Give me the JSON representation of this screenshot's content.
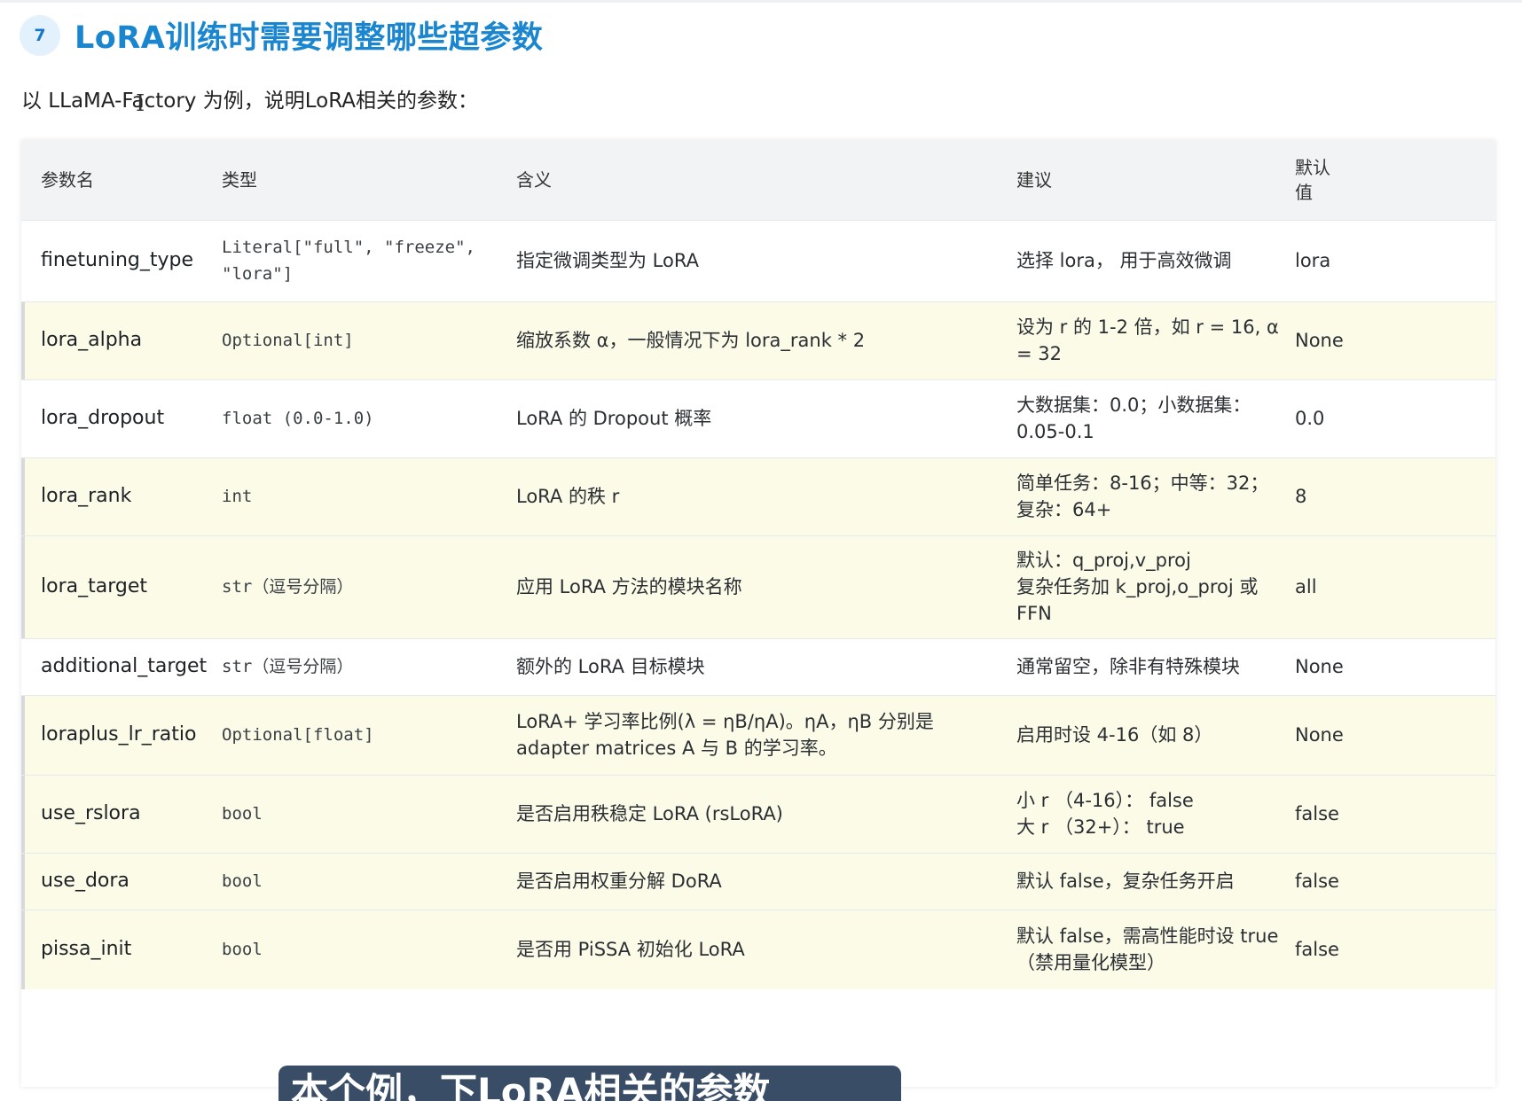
{
  "section": {
    "number": "7",
    "title": "LoRA训练时需要调整哪些超参数"
  },
  "intro": "以 LLaMA-Factory 为例，说明LoRA相关的参数：",
  "cursor": "I",
  "table": {
    "headers": [
      "参数名",
      "类型",
      "含义",
      "建议",
      "默认值"
    ],
    "rows": [
      {
        "name": "finetuning_type",
        "type": "Literal[\"full\", \"freeze\", \"lora\"]",
        "meaning": "指定微调类型为 LoRA",
        "suggestion": "选择 lora， 用于高效微调",
        "default": "lora",
        "alt": false
      },
      {
        "name": "lora_alpha",
        "type": "Optional[int]",
        "meaning": "缩放系数 α，一般情况下为 lora_rank * 2",
        "suggestion": "设为 r 的 1-2 倍，如 r = 16, α = 32",
        "default": "None",
        "alt": true
      },
      {
        "name": "lora_dropout",
        "type": "float (0.0-1.0)",
        "meaning": "LoRA 的 Dropout 概率",
        "suggestion": "大数据集：0.0；小数据集：0.05-0.1",
        "default": "0.0",
        "alt": false
      },
      {
        "name": "lora_rank",
        "type": "int",
        "meaning": "LoRA 的秩 r",
        "suggestion": "简单任务：8-16；中等：32；复杂：64+",
        "default": "8",
        "alt": true
      },
      {
        "name": "lora_target",
        "type": "str（逗号分隔）",
        "meaning": "应用 LoRA 方法的模块名称",
        "suggestion": "默认：q_proj,v_proj\n复杂任务加 k_proj,o_proj 或 FFN",
        "default": "all",
        "alt": true
      },
      {
        "name": "additional_target",
        "type": "str（逗号分隔）",
        "meaning": "额外的 LoRA 目标模块",
        "suggestion": "通常留空，除非有特殊模块",
        "default": "None",
        "alt": false
      },
      {
        "name": "loraplus_lr_ratio",
        "type": "Optional[float]",
        "meaning": "LoRA+ 学习率比例(λ = ηB/ηA)。ηA，ηB 分别是 adapter matrices A 与 B 的学习率。",
        "suggestion": "启用时设 4-16（如 8）",
        "default": "None",
        "alt": true
      },
      {
        "name": "use_rslora",
        "type": "bool",
        "meaning": "是否启用秩稳定 LoRA (rsLoRA)",
        "suggestion": "小 r （4-16）： false\n大 r （32+）： true",
        "default": "false",
        "alt": true
      },
      {
        "name": "use_dora",
        "type": "bool",
        "meaning": "是否启用权重分解 DoRA",
        "suggestion": "默认 false，复杂任务开启",
        "default": "false",
        "alt": true
      },
      {
        "name": "pissa_init",
        "type": "bool",
        "meaning": "是否用 PiSSA 初始化 LoRA",
        "suggestion": "默认 false，需高性能时设 true（禁用量化模型）",
        "default": "false",
        "alt": true
      }
    ]
  },
  "caption_overlay": "本个例，下LoRA相关的参数"
}
